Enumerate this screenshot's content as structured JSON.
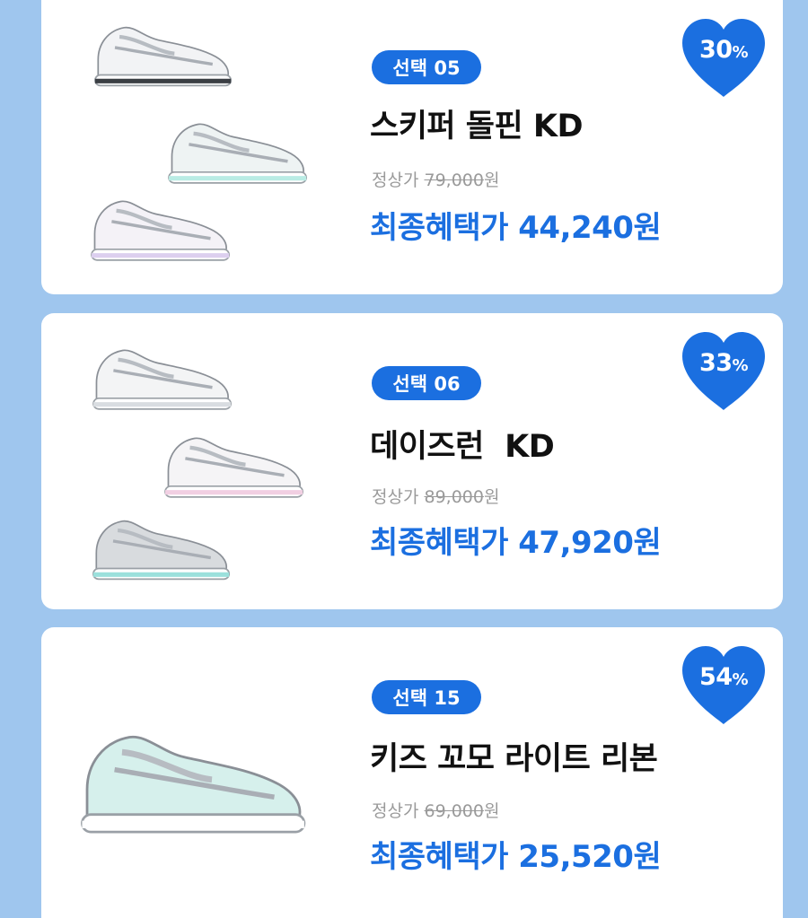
{
  "products": [
    {
      "select_label": "선택 05",
      "name": "스키퍼 돌핀 KD",
      "original_label": "정상가",
      "original_price": "79,000",
      "original_unit": "원",
      "final_label": "최종혜택가",
      "final_price": "44,240원",
      "discount_value": "30",
      "discount_symbol": "%",
      "image_icons": [
        "sneaker-white-grey-icon",
        "sneaker-mint-grey-icon",
        "sneaker-lavender-grey-icon"
      ]
    },
    {
      "select_label": "선택 06",
      "name": "데이즈런  KD",
      "original_label": "정상가",
      "original_price": "89,000",
      "original_unit": "원",
      "final_label": "최종혜택가",
      "final_price": "47,920원",
      "discount_value": "33",
      "discount_symbol": "%",
      "image_icons": [
        "sneaker-white-silver-icon",
        "sneaker-pink-silver-icon",
        "sneaker-black-silver-icon"
      ]
    },
    {
      "select_label": "선택 15",
      "name": "키즈 꼬모 라이트 리본",
      "original_label": "정상가",
      "original_price": "69,000",
      "original_unit": "원",
      "final_label": "최종혜택가",
      "final_price": "25,520원",
      "discount_value": "54",
      "discount_symbol": "%",
      "image_icons": [
        "sneaker-mint-glitter-icon"
      ]
    }
  ],
  "colors": {
    "background": "#9fc6ee",
    "accent_blue": "#1b6fe0",
    "strike_grey": "#9a9a9a"
  }
}
